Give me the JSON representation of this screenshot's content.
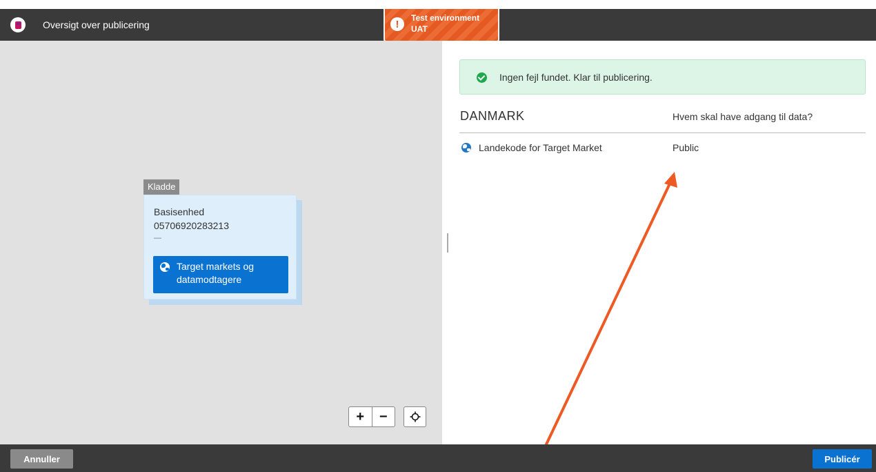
{
  "header": {
    "title": "Oversigt over publicering",
    "app_icon": "product-icon"
  },
  "environment": {
    "line1": "Test environment",
    "line2": "UAT",
    "icon": "alert-icon",
    "color": "#e55a22"
  },
  "diagram": {
    "node": {
      "status_tag": "Kladde",
      "name": "Basisenhed",
      "gtin": "05706920283213",
      "dash": "—",
      "button_label": "Target markets og datamodtagere",
      "button_icon": "globe-icon"
    },
    "controls": {
      "zoom_in": "+",
      "zoom_out": "−",
      "fit_icon": "crosshair-icon"
    }
  },
  "validation": {
    "message": "Ingen fejl fundet. Klar til publicering.",
    "icon": "check-circle-icon",
    "color": "#1fa84e"
  },
  "access_table": {
    "country": "DANMARK",
    "column_header": "Hvem skal have adgang til data?",
    "rows": [
      {
        "label": "Landekode for Target Market",
        "value": "Public",
        "icon": "globe-icon"
      }
    ]
  },
  "footer": {
    "cancel_label": "Annuller",
    "publish_label": "Publicér"
  },
  "colors": {
    "primary": "#0a73d1",
    "header_bg": "#3a3a3a",
    "annotation_arrow": "#ee5a24"
  }
}
